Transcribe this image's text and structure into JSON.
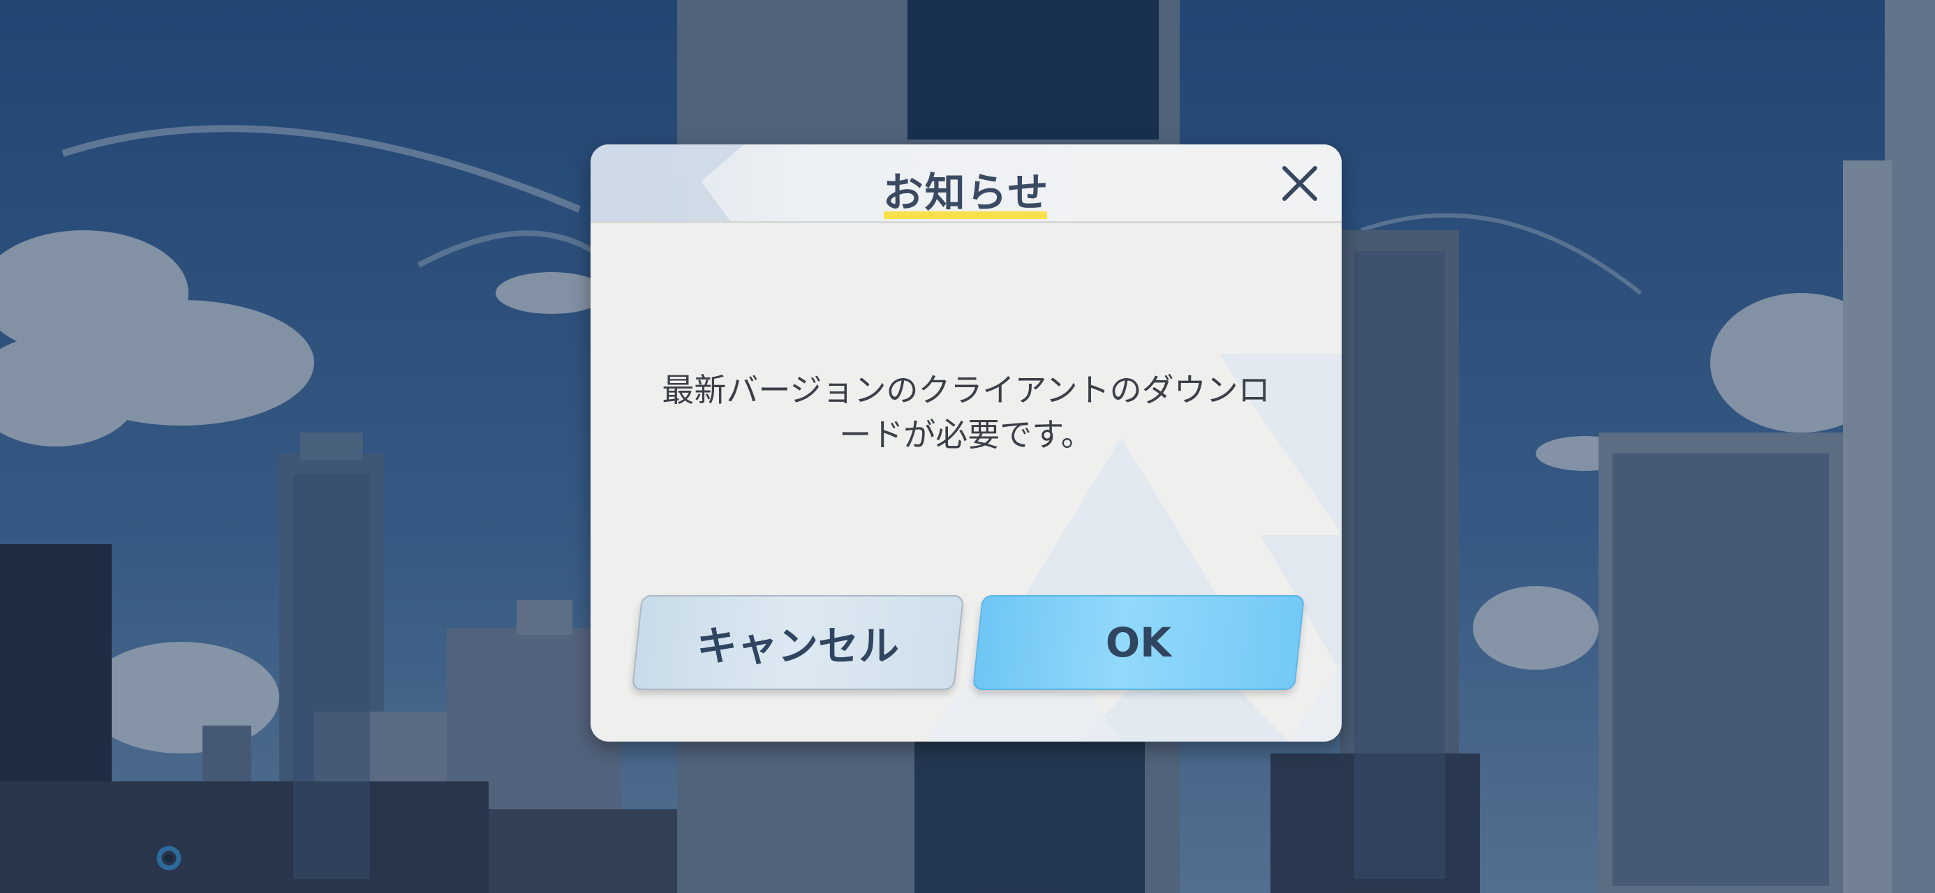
{
  "dialog": {
    "title": "お知らせ",
    "message_line1": "最新バージョンのクライアントのダウンロ",
    "message_line2": "ードが必要です。",
    "cancel_label": "キャンセル",
    "ok_label": "OK"
  },
  "icons": {
    "close": "close-icon",
    "corner": "loading-ring-icon"
  },
  "colors": {
    "title_text": "#3a4a63",
    "title_underline": "#f7e04a",
    "ok_button": "#7fcff7",
    "cancel_button": "#d3e2ee"
  }
}
